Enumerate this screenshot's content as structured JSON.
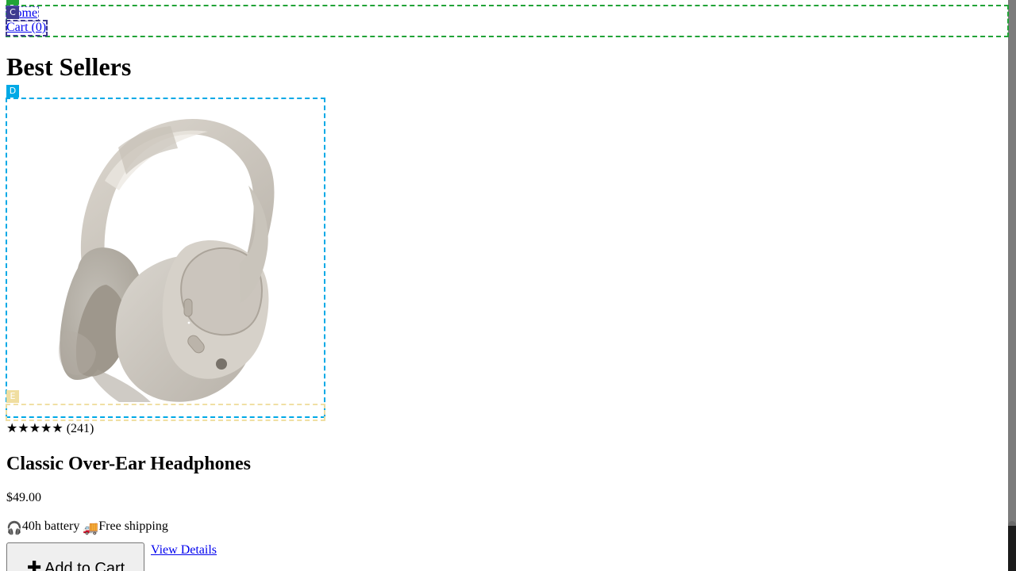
{
  "nav": {
    "home_label": "Home",
    "cart_label": "Cart (0)"
  },
  "page": {
    "title": "Best Sellers"
  },
  "overlay_markers": {
    "nav": "",
    "home": "",
    "cart": "C",
    "product_card": "D",
    "image_overlay": "E"
  },
  "product": {
    "image_label": "headphones",
    "stars": "★★★★★",
    "review_count": "(241)",
    "name": "Classic Over-Ear Headphones",
    "price": "$49.00",
    "features": [
      {
        "icon": "headphones-icon",
        "emoji": "🎧",
        "label": "40h battery"
      },
      {
        "icon": "delivery-truck-icon",
        "emoji": "🚚",
        "label": "Free shipping"
      }
    ],
    "add_to_cart_label": "Add to Cart",
    "add_to_cart_icon": "plus-icon",
    "view_details_label": "View Details"
  },
  "colors": {
    "nav_outline": "#21a337",
    "home_outline": "#5b57bf",
    "cart_outline": "#3e3b8f",
    "product_card_outline": "#00a9e6",
    "image_overlay_outline": "#f0dea0",
    "link": "#0000ee",
    "button_bg": "#efefef",
    "scrollbar_track": "#7c7c7c",
    "scrollbar_thumb": "#1c1c1c"
  }
}
